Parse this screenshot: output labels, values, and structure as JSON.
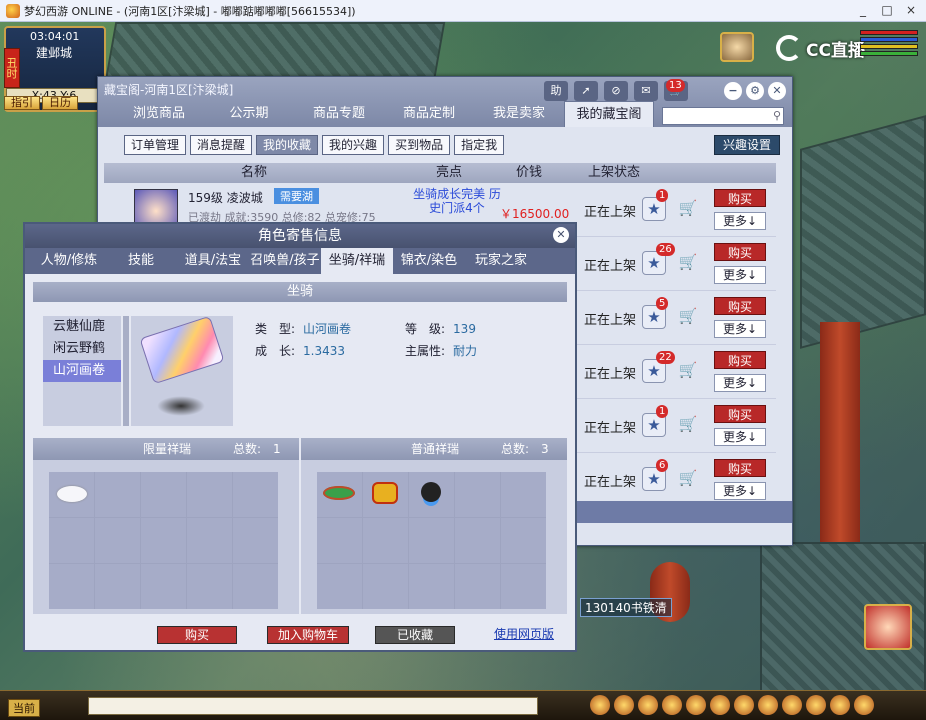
{
  "window": {
    "title": "梦幻西游 ONLINE - (河南1区[汴梁城] - 嘟嘟踮嘟嘟嘟[56615534])",
    "controls": [
      "_",
      "□",
      "×"
    ]
  },
  "hud": {
    "clock": "03:04:01",
    "city": "建邺城",
    "period": "丑时",
    "coords": "X:43  Y:6",
    "buttons": [
      "指引",
      "日历"
    ]
  },
  "stream_logo": "CC直播",
  "shop": {
    "title": "藏宝阁-河南1区[汴梁城]",
    "help_label": "助",
    "notification_count": "13",
    "tabs": [
      "浏览商品",
      "公示期",
      "商品专题",
      "商品定制",
      "我是卖家",
      "我的藏宝阁"
    ],
    "active_tab": 5,
    "subtabs": [
      "订单管理",
      "消息提醒",
      "我的收藏",
      "我的兴趣",
      "买到物品",
      "指定我"
    ],
    "active_subtab": 2,
    "interest_button": "兴趣设置",
    "columns": [
      "名称",
      "亮点",
      "价钱",
      "上架状态"
    ],
    "first_item": {
      "level": "159级 凌波城",
      "tag": "需要湖",
      "highlight": "坐骑成长完美 历史门派4个",
      "price": "￥16500.00",
      "stats": "已渡劫 成就:3590 总修:82 总宠修:75"
    },
    "rows": [
      {
        "status": "正在上架",
        "fav": "1",
        "buy": "购买",
        "more": "更多↓"
      },
      {
        "status": "正在上架",
        "fav": "26",
        "buy": "购买",
        "more": "更多↓"
      },
      {
        "status": "正在上架",
        "fav": "5",
        "buy": "购买",
        "more": "更多↓"
      },
      {
        "status": "正在上架",
        "fav": "22",
        "buy": "购买",
        "more": "更多↓"
      },
      {
        "status": "正在上架",
        "fav": "1",
        "buy": "购买",
        "more": "更多↓"
      },
      {
        "status": "正在上架",
        "fav": "6",
        "buy": "购买",
        "more": "更多↓"
      }
    ]
  },
  "dialog": {
    "title": "角色寄售信息",
    "tabs": [
      "人物/修炼",
      "技能",
      "道具/法宝",
      "召唤兽/孩子",
      "坐骑/祥瑞",
      "锦衣/染色",
      "玩家之家"
    ],
    "active_tab": 4,
    "section": "坐骑",
    "mounts": [
      "云魅仙鹿",
      "闲云野鹤",
      "山河画卷"
    ],
    "selected_mount": 2,
    "attrs": {
      "type_label": "类　型:",
      "type_value": "山河画卷",
      "level_label": "等　级:",
      "level_value": "139",
      "growth_label": "成　长:",
      "growth_value": "1.3433",
      "main_label": "主属性:",
      "main_value": "耐力"
    },
    "limited": {
      "label": "限量祥瑞",
      "total_label": "总数:",
      "total": "1",
      "items": [
        "white-fox-icon"
      ]
    },
    "normal": {
      "label": "普通祥瑞",
      "total_label": "总数:",
      "total": "3",
      "items": [
        "turtle-icon",
        "golden-beast-icon",
        "black-bird-icon"
      ]
    },
    "buttons": {
      "buy": "购买",
      "cart": "加入购物车",
      "favorited": "已收藏",
      "web": "使用网页版"
    }
  },
  "scene": {
    "nametag": "130140书铁清"
  },
  "bottombar": {
    "channel": "当前"
  }
}
